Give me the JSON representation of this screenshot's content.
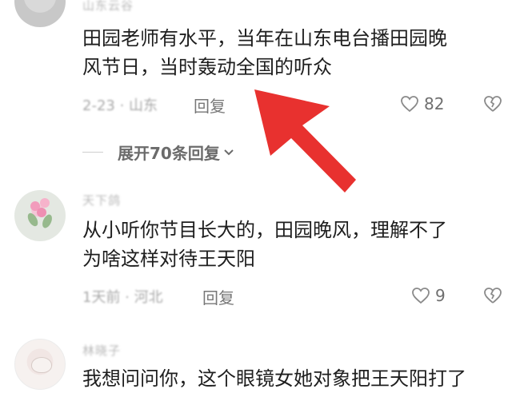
{
  "comments": [
    {
      "username": "山东云谷",
      "text_lines": [
        "田园老师有水平，当年在山东电台播田园晚",
        "风节日，当时轰动全国的听众"
      ],
      "meta": "2-23 · 山东",
      "reply_label": "回复",
      "like_count": "82"
    },
    {
      "username": "天下鸽",
      "text_lines": [
        "从小听你节目长大的，田园晚风，理解不了",
        "为啥这样对待王天阳"
      ],
      "meta": "1天前 · 河北",
      "reply_label": "回复",
      "like_count": "9"
    },
    {
      "username": "林晓子",
      "text_lines": [
        "我想问问你，这个眼镜女她对象把王天阳打了"
      ],
      "meta": "",
      "reply_label": "",
      "like_count": ""
    }
  ],
  "expand_replies_label": "展开70条回复",
  "icons": {
    "like": "heart-outline-icon",
    "dislike": "broken-heart-icon",
    "expand": "chevron-down-icon",
    "annotation": "red-arrow-annotation"
  },
  "colors": {
    "arrow": "#e8312f",
    "text": "#1e1e1e",
    "secondary": "#777777"
  }
}
